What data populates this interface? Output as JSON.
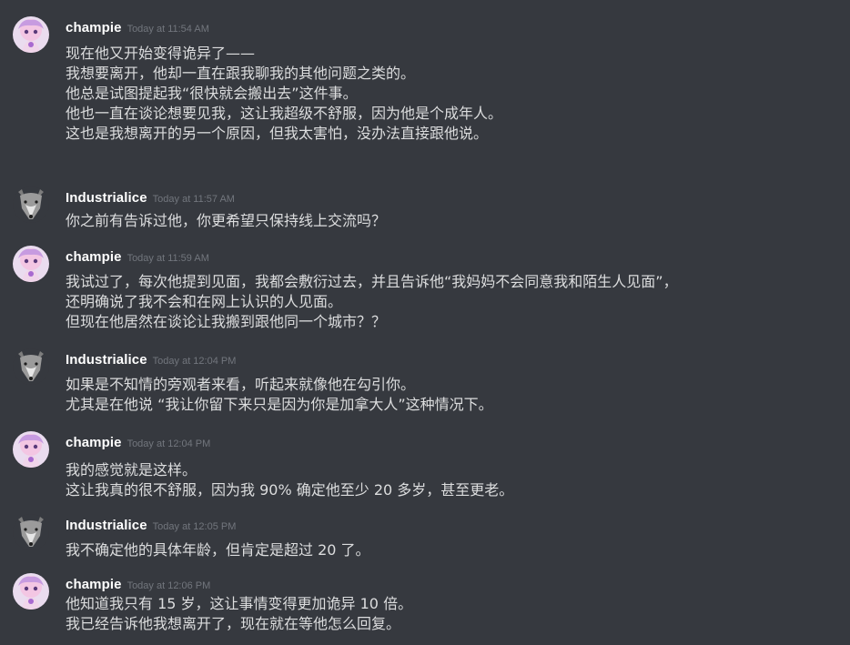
{
  "messages": [
    {
      "author": "champie",
      "avatar_icon": "champie-avatar-icon",
      "time": "Today at 11:54 AM",
      "lines": [
        "现在他又开始变得诡异了——",
        "我想要离开，他却一直在跟我聊我的其他问题之类的。",
        "他总是试图提起我“很快就会搬出去”这件事。",
        "他也一直在谈论想要见我，这让我超级不舒服，因为他是个成年人。",
        "这也是我想离开的另一个原因，但我太害怕，没办法直接跟他说。"
      ]
    },
    {
      "author": "Industrialice",
      "avatar_icon": "wolf-avatar-icon",
      "time": "Today at 11:57 AM",
      "lines": [
        "你之前有告诉过他，你更希望只保持线上交流吗？"
      ]
    },
    {
      "author": "champie",
      "avatar_icon": "champie-avatar-icon",
      "time": "Today at 11:59 AM",
      "lines": [
        "我试过了，每次他提到见面，我都会敷衍过去，并且告诉他“我妈妈不会同意我和陌生人见面”，",
        "还明确说了我不会和在网上认识的人见面。",
        "但现在他居然在谈论让我搬到跟他同一个城市？？"
      ]
    },
    {
      "author": "Industrialice",
      "avatar_icon": "wolf-avatar-icon",
      "time": "Today at 12:04 PM",
      "lines": [
        "如果是不知情的旁观者来看，听起来就像他在勾引你。",
        "尤其是在他说 “我让你留下来只是因为你是加拿大人”这种情况下。"
      ]
    },
    {
      "author": "champie",
      "avatar_icon": "champie-avatar-icon",
      "time": "Today at 12:04 PM",
      "lines": [
        "我的感觉就是这样。",
        "这让我真的很不舒服，因为我 90% 确定他至少 20 多岁，甚至更老。"
      ]
    },
    {
      "author": "Industrialice",
      "avatar_icon": "wolf-avatar-icon",
      "time": "Today at 12:05 PM",
      "lines": [
        "我不确定他的具体年龄，但肯定是超过 20 了。"
      ]
    },
    {
      "author": "champie",
      "avatar_icon": "champie-avatar-icon",
      "time": "Today at 12:06 PM",
      "lines": [
        "他知道我只有 15 岁，这让事情变得更加诡异 10 倍。",
        "我已经告诉他我想离开了，现在就在等他怎么回复。"
      ]
    }
  ],
  "colors": {
    "background": "#36393f",
    "username": "#ffffff",
    "timestamp": "#72767d",
    "text": "#dcddde"
  }
}
